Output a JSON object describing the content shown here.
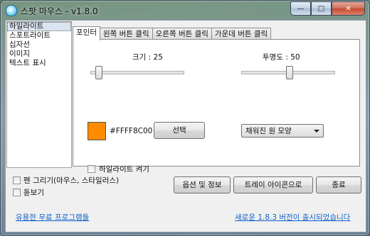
{
  "window": {
    "title": "스팟 마우스 - v1.8.0",
    "icon": "app-icon"
  },
  "caption_buttons": {
    "minimize": "—",
    "maximize": "□",
    "close": "✕"
  },
  "sidebar": {
    "items": [
      {
        "label": "하일라이트",
        "selected": true
      },
      {
        "label": "스포트라이트",
        "selected": false
      },
      {
        "label": "십자선",
        "selected": false
      },
      {
        "label": "이미지",
        "selected": false
      },
      {
        "label": "텍스트 표시",
        "selected": false
      }
    ]
  },
  "tabs": [
    {
      "label": "포인터",
      "active": true
    },
    {
      "label": "왼쪽 버튼 클릭",
      "active": false
    },
    {
      "label": "오른쪽 버튼 클릭",
      "active": false
    },
    {
      "label": "가운데 버튼 클릭",
      "active": false
    }
  ],
  "pointer": {
    "size_label": "크기 :  25",
    "size_value": 25,
    "opacity_label": "투명도 : 50",
    "opacity_value": 50,
    "color_hex": "#FFFF8C00",
    "color_swatch": "#FF8C00",
    "select_button": "선택",
    "shape_dropdown": "채워진 원 모양",
    "enable_highlight_label": "하일라이트 켜기",
    "enable_highlight_checked": false
  },
  "footer": {
    "pen_draw_label": "펜 그리기(마우스, 스타일러스)",
    "pen_draw_checked": false,
    "magnifier_label": "돋보기",
    "magnifier_checked": false,
    "options_button": "옵션 및 정보",
    "tray_button": "트레이 아이콘으로",
    "exit_button": "종료",
    "free_programs_link": "유용한 무료 프로그램들",
    "update_link": "새로운 1.8.3 버전이 출시되었습니다"
  }
}
